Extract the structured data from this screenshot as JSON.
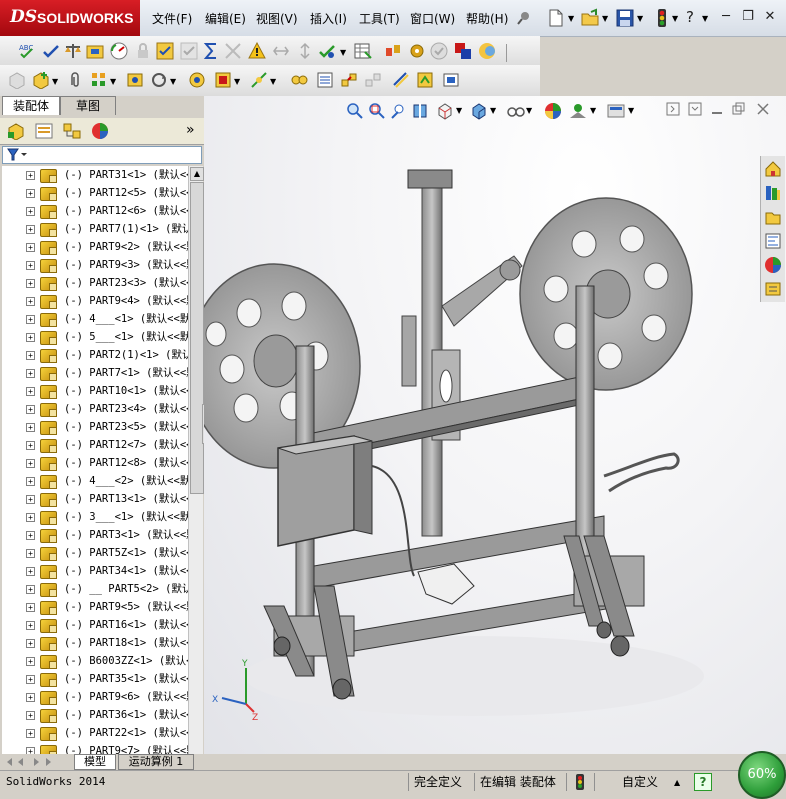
{
  "app": {
    "brand_ds": "DS",
    "brand_name": "SOLIDWORKS"
  },
  "menu": [
    "文件(F)",
    "编辑(E)",
    "视图(V)",
    "插入(I)",
    "工具(T)",
    "窗口(W)",
    "帮助(H)"
  ],
  "window_controls": {
    "help": "?",
    "minimize": "─",
    "restore": "❐",
    "close": "✕"
  },
  "panel": {
    "tabs": [
      "装配体",
      "草图"
    ],
    "expand_chevron": "»",
    "filter_icon": "filter-icon"
  },
  "tree_items": [
    "(-) PART31<1> (默认<<",
    "(-) PART12<5> (默认<<",
    "(-) PART12<6> (默认<<",
    "(-) PART7(1)<1> (默认",
    "(-) PART9<2> (默认<<默",
    "(-) PART9<3> (默认<<默",
    "(-) PART23<3> (默认<<",
    "(-) PART9<4> (默认<<默",
    "(-) 4___<1> (默认<<默",
    "(-) 5___<1> (默认<<默",
    "(-) PART2(1)<1> (默认",
    "(-) PART7<1> (默认<<默",
    "(-) PART10<1> (默认<<",
    "(-) PART23<4> (默认<<",
    "(-) PART23<5> (默认<<",
    "(-) PART12<7> (默认<<",
    "(-) PART12<8> (默认<<",
    "(-) 4___<2> (默认<<默",
    "(-) PART13<1> (默认<<",
    "(-) 3___<1> (默认<<默",
    "(-) PART3<1> (默认<<默",
    "(-) PART5Z<1> (默认<<",
    "(-) PART34<1> (默认<<",
    "(-) __ PART5<2> (默认",
    "(-) PART9<5> (默认<<默",
    "(-) PART16<1> (默认<<",
    "(-) PART18<1> (默认<<",
    "(-) B6003ZZ<1> (默认<",
    "(-) PART35<1> (默认<<",
    "(-) PART9<6> (默认<<默",
    "(-) PART36<1> (默认<<",
    "(-) PART22<1> (默认<<",
    "(-) PART9<7> (默认<<默"
  ],
  "bottom_tabs": [
    "模型",
    "运动算例 1"
  ],
  "status": {
    "app_version": "SolidWorks 2014",
    "definition": "完全定义",
    "editing": "在编辑 装配体",
    "units": "自定义",
    "help": "?",
    "progress_label": "60%"
  },
  "colors": {
    "brand_red": "#c8101a",
    "tree_bg": "#ffffff",
    "viewport_bg": "#f4f4f6",
    "progress_green": "#2e9e3a"
  }
}
